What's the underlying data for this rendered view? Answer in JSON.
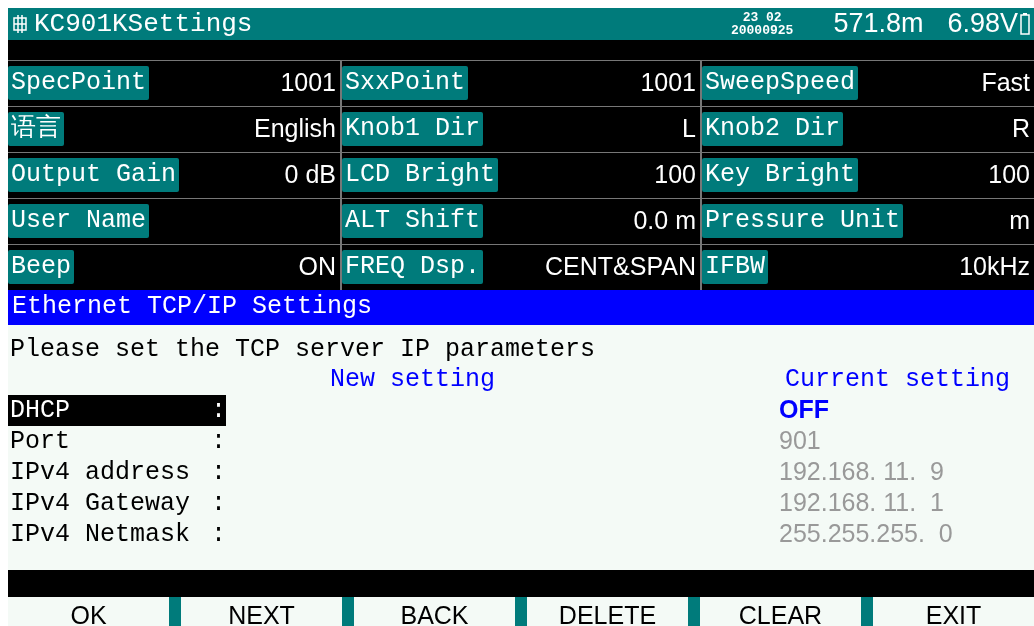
{
  "title_bar": {
    "title": "KC901KSettings",
    "time": "23 02",
    "date": "20000925",
    "altitude": "571.8m",
    "voltage": "6.98V"
  },
  "settings": [
    {
      "label": "SpecPoint",
      "value": "1001"
    },
    {
      "label": "SxxPoint",
      "value": "1001"
    },
    {
      "label": "SweepSpeed",
      "value": "Fast"
    },
    {
      "label": "语言",
      "value": "English"
    },
    {
      "label": "Knob1 Dir",
      "value": "L"
    },
    {
      "label": "Knob2 Dir",
      "value": "R"
    },
    {
      "label": "Output Gain",
      "value": "0 dB"
    },
    {
      "label": "LCD Bright",
      "value": "100"
    },
    {
      "label": "Key Bright",
      "value": "100"
    },
    {
      "label": "User Name"
    },
    {
      "label": "ALT Shift",
      "value": "0.0 m"
    },
    {
      "label": "Pressure Unit",
      "value": "m"
    },
    {
      "label": "Beep",
      "value": "ON"
    },
    {
      "label": "FREQ Dsp.",
      "value": "CENT&SPAN"
    },
    {
      "label": "IFBW",
      "value": "10kHz"
    }
  ],
  "dialog": {
    "title": "Ethernet TCP/IP Settings",
    "prompt": "Please set the TCP server IP parameters",
    "new_heading": "New setting",
    "current_heading": "Current setting",
    "fields": [
      {
        "label": "DHCP",
        "colon": ":",
        "current": "OFF",
        "selected": true
      },
      {
        "label": "Port",
        "colon": ":",
        "current": "901",
        "selected": false
      },
      {
        "label": "IPv4 address",
        "colon": ":",
        "current": "192.168. 11.  9",
        "selected": false
      },
      {
        "label": "IPv4 Gateway",
        "colon": ":",
        "current": "192.168. 11.  1",
        "selected": false
      },
      {
        "label": "IPv4 Netmask",
        "colon": ":",
        "current": "255.255.255.  0",
        "selected": false
      }
    ]
  },
  "softkeys": [
    "OK",
    "NEXT",
    "BACK",
    "DELETE",
    "CLEAR",
    "EXIT"
  ]
}
